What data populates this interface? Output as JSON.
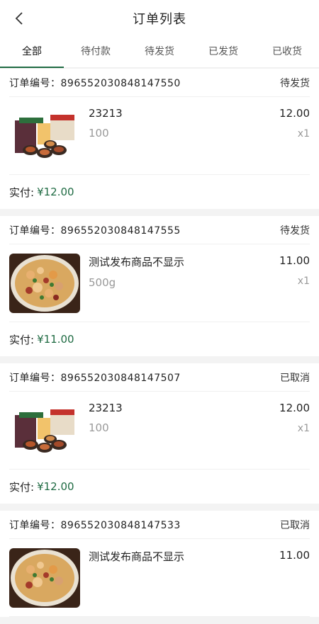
{
  "header": {
    "title": "订单列表",
    "back_icon": "chevron-left-icon"
  },
  "tabs": [
    {
      "label": "全部",
      "active": true
    },
    {
      "label": "待付款",
      "active": false
    },
    {
      "label": "待发货",
      "active": false
    },
    {
      "label": "已发货",
      "active": false
    },
    {
      "label": "已收货",
      "active": false
    }
  ],
  "orders": [
    {
      "order_label": "订单编号：",
      "order_no": "896552030848147550",
      "status": "待发货",
      "product_name": "23213",
      "spec": "100",
      "price": "12.00",
      "qty": "x1",
      "thumb": "gift-box-food",
      "paid_label": "实付:",
      "paid_amount": "¥12.00"
    },
    {
      "order_label": "订单编号：",
      "order_no": "896552030848147555",
      "status": "待发货",
      "product_name": "测试发布商品不显示",
      "spec": "500g",
      "price": "11.00",
      "qty": "x1",
      "thumb": "stir-fry-dish",
      "paid_label": "实付:",
      "paid_amount": "¥11.00"
    },
    {
      "order_label": "订单编号：",
      "order_no": "896552030848147507",
      "status": "已取消",
      "product_name": "23213",
      "spec": "100",
      "price": "12.00",
      "qty": "x1",
      "thumb": "gift-box-food",
      "paid_label": "实付:",
      "paid_amount": "¥12.00"
    },
    {
      "order_label": "订单编号：",
      "order_no": "896552030848147533",
      "status": "已取消",
      "product_name": "测试发布商品不显示",
      "spec": "",
      "price": "11.00",
      "qty": "",
      "thumb": "stir-fry-dish",
      "paid_label": "",
      "paid_amount": ""
    }
  ],
  "colors": {
    "accent": "#1f6b43",
    "muted": "#999999"
  }
}
